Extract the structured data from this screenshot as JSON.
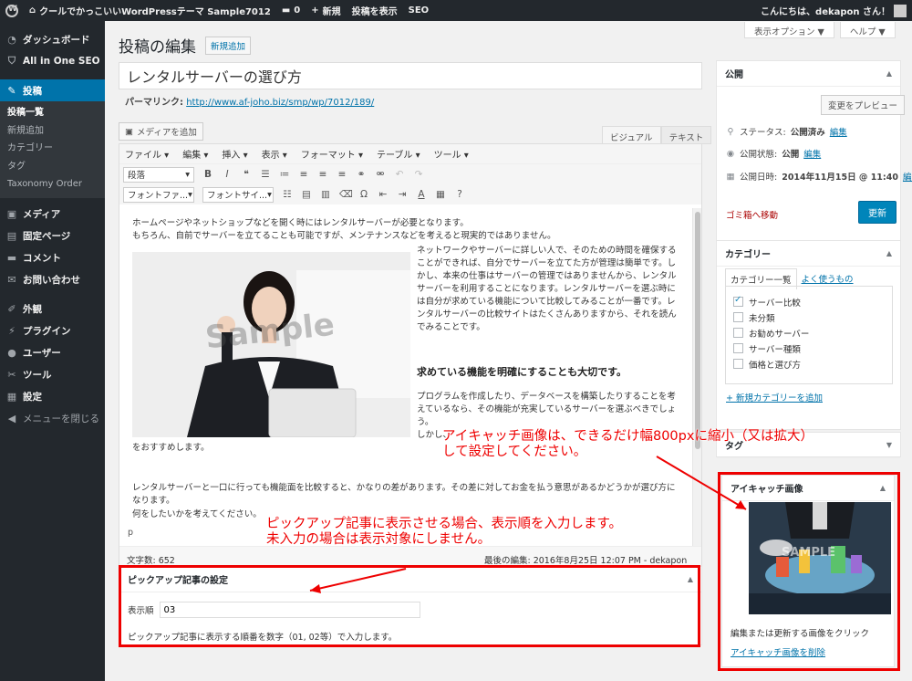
{
  "admin_bar": {
    "site_name": "クールでかっこいいWordPressテーマ Sample7012",
    "comments_count": "0",
    "new_label": "新規",
    "view_post_label": "投稿を表示",
    "seo_label": "SEO",
    "greeting": "こんにちは、dekapon さん！"
  },
  "sidebar": {
    "items": [
      {
        "label": "ダッシュボード",
        "icon": "dashboard-icon"
      },
      {
        "label": "All in One SEO",
        "icon": "shield-icon"
      },
      {
        "label": "投稿",
        "icon": "pin-icon"
      },
      {
        "label": "メディア",
        "icon": "media-icon"
      },
      {
        "label": "固定ページ",
        "icon": "page-icon"
      },
      {
        "label": "コメント",
        "icon": "comment-icon"
      },
      {
        "label": "お問い合わせ",
        "icon": "mail-icon"
      },
      {
        "label": "外観",
        "icon": "brush-icon"
      },
      {
        "label": "プラグイン",
        "icon": "plugin-icon"
      },
      {
        "label": "ユーザー",
        "icon": "user-icon"
      },
      {
        "label": "ツール",
        "icon": "wrench-icon"
      },
      {
        "label": "設定",
        "icon": "settings-icon"
      }
    ],
    "submenu": [
      "投稿一覧",
      "新規追加",
      "カテゴリー",
      "タグ",
      "Taxonomy Order"
    ],
    "collapse_label": "メニューを閉じる"
  },
  "screen_options": {
    "options_label": "表示オプション ▼",
    "help_label": "ヘルプ ▼"
  },
  "page": {
    "title": "投稿の編集",
    "add_new_label": "新規追加",
    "post_title": "レンタルサーバーの選び方",
    "permalink_label": "パーマリンク:",
    "permalink_url": "http://www.af-joho.biz/smp/wp/7012/189/"
  },
  "editor": {
    "add_media_label": "メディアを追加",
    "tab_visual": "ビジュアル",
    "tab_text": "テキスト",
    "menus": [
      "ファイル ▾",
      "編集 ▾",
      "挿入 ▾",
      "表示 ▾",
      "フォーマット ▾",
      "テーブル ▾",
      "ツール ▾"
    ],
    "format_select": "段落",
    "font_family_select": "フォントファ...",
    "font_size_select": "フォントサイ...",
    "content": {
      "p1_line1": "ホームページやネットショップなどを開く時にはレンタルサーバーが必要となります。",
      "p1_line2": "もちろん、自前でサーバーを立てることも可能ですが、メンテナンスなどを考えると現実的ではありません。",
      "image_watermark": "Sample",
      "p2": "ネットワークやサーバーに詳しい人で、そのための時間を確保することができれば、自分でサーバーを立てた方が管理は簡単です。しかし、本来の仕事はサーバーの管理ではありませんから、レンタルサーバーを利用することになります。レンタルサーバーを選ぶ時には自分が求めている機能について比較してみることが一番です。レンタルサーバーの比較サイトはたくさんありますから、それを読んでみることです。",
      "heading": "求めている機能を明確にすることも大切です。",
      "p3": "プログラムを作成したり、データベースを構築したりすることを考えているなら、その機能が充実しているサーバーを選ぶべきでしょう。",
      "p3_cut": "しかし、",
      "p3_end": "をおすすめします。",
      "p4_line1": "レンタルサーバーと一口に行っても機能面を比較すると、かなりの差があります。その差に対してお金を払う意思があるかどうかが選び方になります。",
      "p4_line2": "何をしたいかを考えてください。"
    },
    "path": "p",
    "word_count": "文字数: 652",
    "last_edit": "最後の編集: 2016年8月25日 12:07 PM - dekapon"
  },
  "pickup": {
    "title": "ピックアップ記事の設定",
    "order_label": "表示順",
    "order_value": "03",
    "help": "ピックアップ記事に表示する順番を数字（01, 02等）で入力します。"
  },
  "publish": {
    "title": "公開",
    "preview_label": "変更をプレビュー",
    "status_label": "ステータス:",
    "status_value": "公開済み",
    "visibility_label": "公開状態:",
    "visibility_value": "公開",
    "date_label": "公開日時:",
    "date_value": "2014年11月15日 @ 11:40",
    "edit_link": "編集",
    "trash_label": "ゴミ箱へ移動",
    "update_label": "更新"
  },
  "categories": {
    "title": "カテゴリー",
    "tab_all": "カテゴリー一覧",
    "tab_popular": "よく使うもの",
    "items": [
      {
        "label": "サーバー比較",
        "checked": true
      },
      {
        "label": "未分類",
        "checked": false
      },
      {
        "label": "お勧めサーバー",
        "checked": false
      },
      {
        "label": "サーバー種類",
        "checked": false
      },
      {
        "label": "価格と選び方",
        "checked": false
      }
    ],
    "add_new_label": "+ 新規カテゴリーを追加"
  },
  "tags": {
    "title": "タグ"
  },
  "featured": {
    "title": "アイキャッチ画像",
    "image_watermark": "SAMPLE",
    "edit_hint": "編集または更新する画像をクリック",
    "remove_label": "アイキャッチ画像を削除"
  },
  "annotations": {
    "featured_line1": "アイキャッチ画像は、できるだけ幅800pxに縮小（又は拡大）",
    "featured_line2": "して設定してください。",
    "pickup_line1": "ピックアップ記事に表示させる場合、表示順を入力します。",
    "pickup_line2": "未入力の場合は表示対象にしません。"
  },
  "colors": {
    "annotation_red": "#ee0000",
    "accent_blue": "#0073aa",
    "admin_dark": "#23282d"
  }
}
